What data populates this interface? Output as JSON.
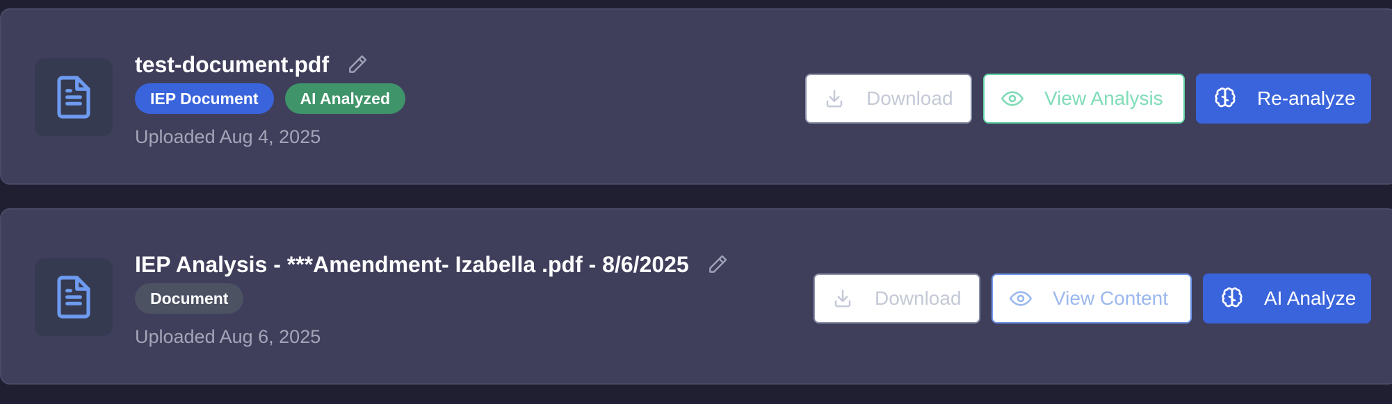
{
  "documents": [
    {
      "title": "test-document.pdf",
      "badges": [
        {
          "label": "IEP Document",
          "color": "#3a64dc"
        },
        {
          "label": "AI Analyzed",
          "color": "#3f946a"
        }
      ],
      "uploaded": "Uploaded Aug 4, 2025",
      "actions": {
        "download_label": "Download",
        "view_label": "View Analysis",
        "analyze_label": "Re-analyze"
      }
    },
    {
      "title": "IEP Analysis - ***Amendment- Izabella .pdf - 8/6/2025",
      "badges": [
        {
          "label": "Document",
          "color": "#4c5262"
        }
      ],
      "uploaded": "Uploaded Aug 6, 2025",
      "actions": {
        "download_label": "Download",
        "view_label": "View Content",
        "analyze_label": "AI Analyze"
      }
    }
  ],
  "icons": {
    "file": "file-text-icon",
    "edit": "pencil-icon",
    "download": "download-icon",
    "view": "eye-icon",
    "analyze": "brain-icon"
  },
  "colors": {
    "page_bg": "#1f1f31",
    "card_bg": "#3f3f5c",
    "accent_blue": "#3a64dc",
    "accent_green": "#3f946a"
  }
}
